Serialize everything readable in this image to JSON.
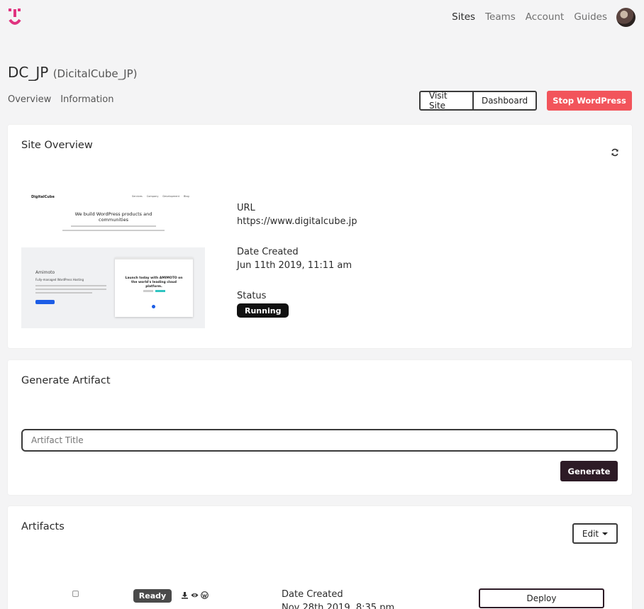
{
  "nav": {
    "items": [
      "Sites",
      "Teams",
      "Account",
      "Guides"
    ],
    "active": "Sites"
  },
  "site": {
    "name": "DC_JP",
    "team": "(DicitalCube_JP)"
  },
  "subnav": [
    "Overview",
    "Information"
  ],
  "actions": {
    "visit": "Visit Site",
    "dashboard": "Dashboard",
    "stop": "Stop WordPress"
  },
  "overview": {
    "title": "Site Overview",
    "url_label": "URL",
    "url": "https://www.digitalcube.jp",
    "created_label": "Date Created",
    "created": "Jun 11th 2019, 11:11 am",
    "status_label": "Status",
    "status": "Running",
    "preview": {
      "brand": "DigitalCube",
      "menu": [
        "Services",
        "Company",
        "Development",
        "Blog"
      ],
      "headline": "We build WordPress products and communities",
      "product": "Amimoto",
      "product_sub": "Fully-managed WordPress Hosting",
      "promo": "Launch today with AMIMOTO on the world's leading cloud platform."
    }
  },
  "generate": {
    "title": "Generate Artifact",
    "placeholder": "Artifact Title",
    "button": "Generate"
  },
  "artifacts": {
    "title": "Artifacts",
    "edit": "Edit",
    "rows": [
      {
        "status": "Ready",
        "created_label": "Date Created",
        "created": "Nov 28th 2019, 8:35 pm",
        "action": "Deploy"
      }
    ]
  },
  "colors": {
    "brand": "#e0337f",
    "danger": "#f2545b",
    "dark": "#2d1b26"
  }
}
